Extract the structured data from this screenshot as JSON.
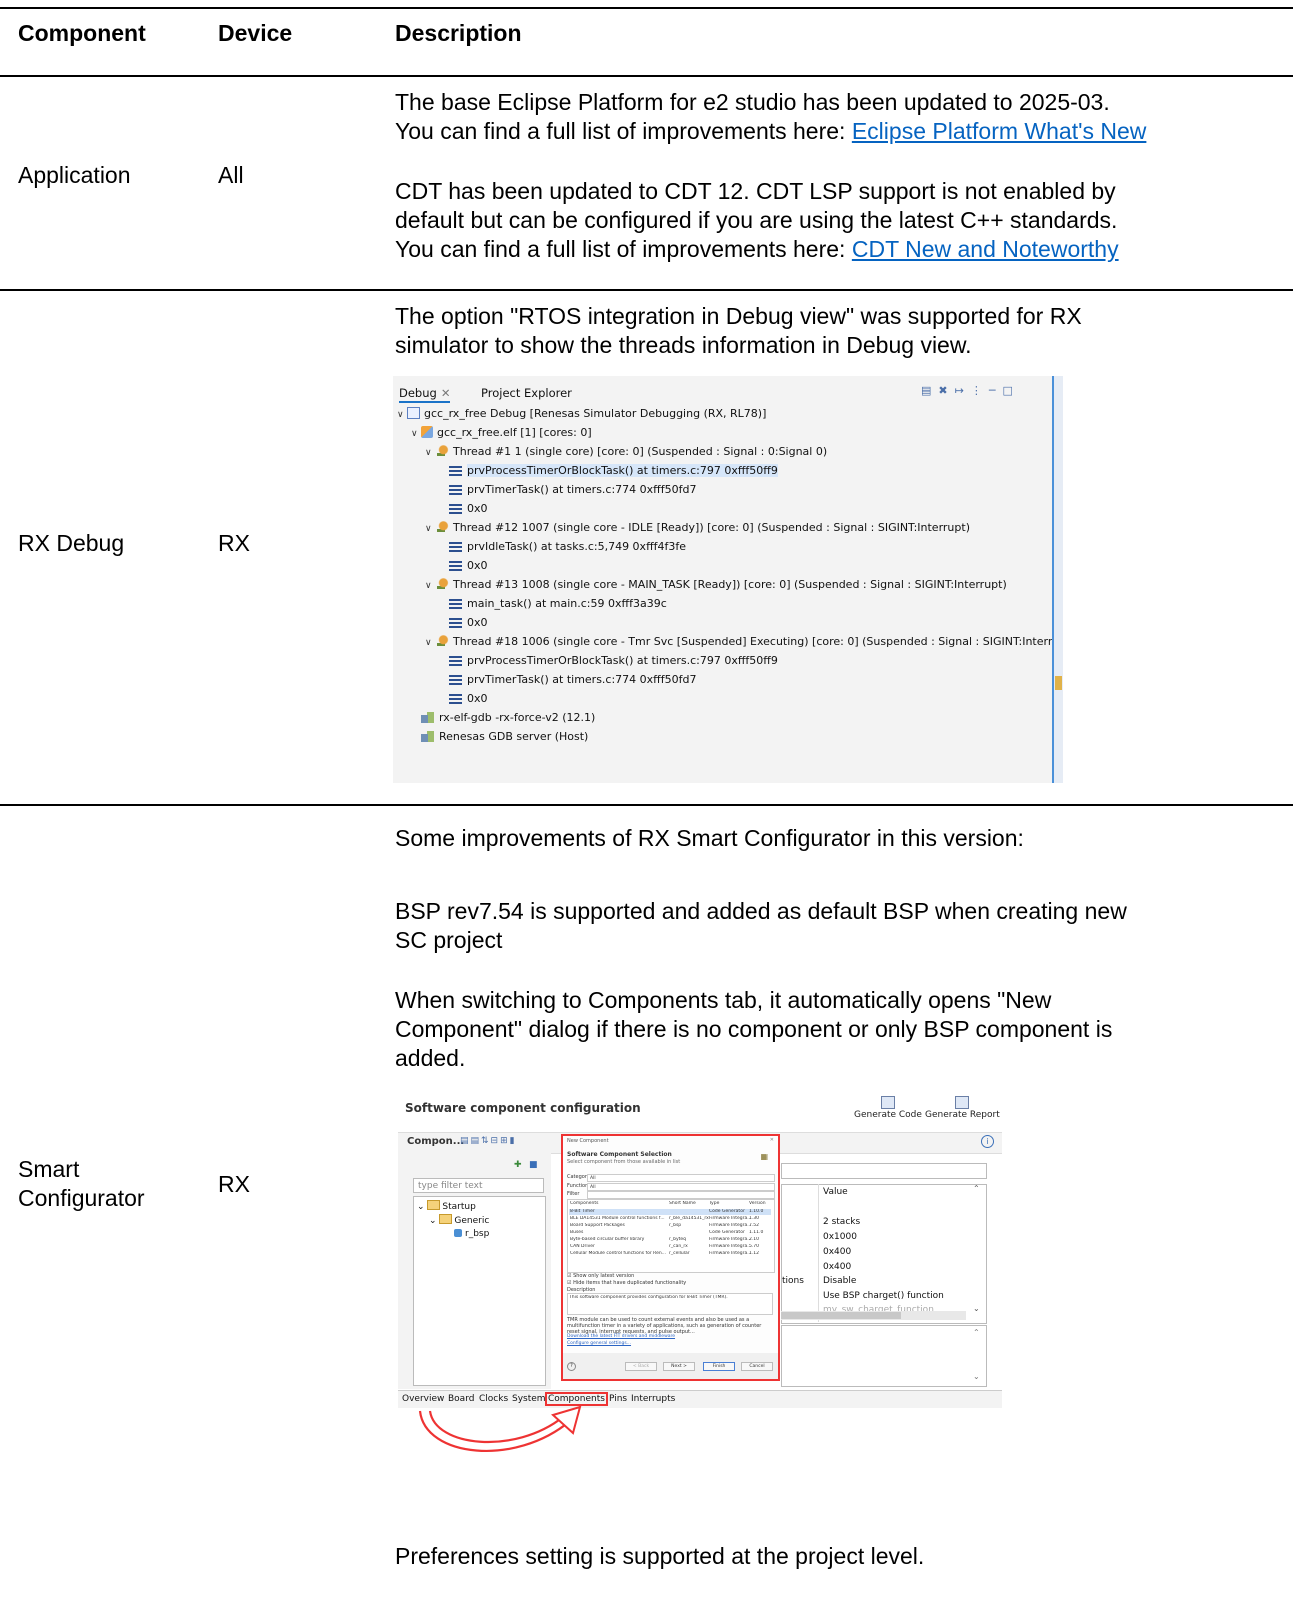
{
  "table": {
    "headers": [
      "Component",
      "Device",
      "Description"
    ],
    "rows": [
      {
        "component": "Application",
        "device": "All",
        "paragraphs": [
          {
            "lines": [
              "The base Eclipse Platform for e2 studio has been updated to 2025-03.",
              "You can find a full list of improvements here: "
            ],
            "link": "Eclipse Platform What's New"
          },
          {
            "lines": [
              "CDT has been updated to CDT 12. CDT LSP support is not enabled by",
              "default but can be configured if you are using the latest C++ standards.",
              "You can find a full list of improvements here: "
            ],
            "link": "CDT New and Noteworthy"
          }
        ]
      },
      {
        "component": "RX Debug",
        "device": "RX",
        "paragraphs": [
          {
            "lines": [
              "The option \"RTOS integration in Debug view\" was supported for RX",
              "simulator to show the threads information in Debug view."
            ]
          }
        ]
      },
      {
        "component_lines": [
          "Smart",
          "Configurator"
        ],
        "device": "RX",
        "paragraphs": [
          {
            "lines": [
              "Some improvements of RX Smart Configurator in this version:"
            ]
          },
          {
            "lines": [
              "BSP rev7.54 is supported and added as default BSP when creating new",
              "SC project"
            ]
          },
          {
            "lines": [
              "When switching to Components tab, it automatically opens \"New",
              "Component\" dialog if there is no component or only BSP component is",
              "added."
            ]
          },
          {
            "lines": [
              "Preferences setting is supported at the project level."
            ]
          }
        ]
      }
    ]
  },
  "debug_view": {
    "tabs": [
      "Debug",
      "Project Explorer"
    ],
    "close_glyph": "✕",
    "toolbar_icons": [
      "collapse-all-icon",
      "remove-terminated-icon",
      "step-icon",
      "view-menu-icon",
      "minimize-icon",
      "maximize-icon"
    ],
    "rows": [
      {
        "indent": 0,
        "chevron": true,
        "icon": "project-icon",
        "text": "gcc_rx_free Debug [Renesas Simulator Debugging (RX, RL78)]"
      },
      {
        "indent": 1,
        "chevron": true,
        "icon": "elf-icon",
        "text": "gcc_rx_free.elf [1] [cores: 0]"
      },
      {
        "indent": 2,
        "chevron": true,
        "icon": "thread-icon",
        "text": "Thread #1 1 (single core) [core: 0] (Suspended : Signal : 0:Signal 0)"
      },
      {
        "indent": 3,
        "chevron": false,
        "icon": "stack-frame-icon",
        "text": "prvProcessTimerOrBlockTask() at timers.c:797 0xfff50ff9",
        "selected": true
      },
      {
        "indent": 3,
        "chevron": false,
        "icon": "stack-frame-icon",
        "text": "prvTimerTask() at timers.c:774 0xfff50fd7"
      },
      {
        "indent": 3,
        "chevron": false,
        "icon": "stack-frame-icon",
        "text": "0x0"
      },
      {
        "indent": 2,
        "chevron": true,
        "icon": "thread-icon",
        "text": "Thread #12 1007 (single core - IDLE [Ready]) [core: 0] (Suspended : Signal : SIGINT:Interrupt)"
      },
      {
        "indent": 3,
        "chevron": false,
        "icon": "stack-frame-icon",
        "text": "prvIdleTask() at tasks.c:5,749 0xfff4f3fe"
      },
      {
        "indent": 3,
        "chevron": false,
        "icon": "stack-frame-icon",
        "text": "0x0"
      },
      {
        "indent": 2,
        "chevron": true,
        "icon": "thread-icon",
        "text": "Thread #13 1008 (single core - MAIN_TASK [Ready]) [core: 0] (Suspended : Signal : SIGINT:Interrupt)"
      },
      {
        "indent": 3,
        "chevron": false,
        "icon": "stack-frame-icon",
        "text": "main_task() at main.c:59 0xfff3a39c"
      },
      {
        "indent": 3,
        "chevron": false,
        "icon": "stack-frame-icon",
        "text": "0x0"
      },
      {
        "indent": 2,
        "chevron": true,
        "icon": "thread-icon",
        "text": "Thread #18 1006 (single core - Tmr Svc [Suspended] Executing) [core: 0] (Suspended : Signal : SIGINT:Interrupt)"
      },
      {
        "indent": 3,
        "chevron": false,
        "icon": "stack-frame-icon",
        "text": "prvProcessTimerOrBlockTask() at timers.c:797 0xfff50ff9"
      },
      {
        "indent": 3,
        "chevron": false,
        "icon": "stack-frame-icon",
        "text": "prvTimerTask() at timers.c:774 0xfff50fd7"
      },
      {
        "indent": 3,
        "chevron": false,
        "icon": "stack-frame-icon",
        "text": "0x0"
      },
      {
        "indent": 1,
        "chevron": false,
        "icon": "gdb-icon",
        "text": "rx-elf-gdb -rx-force-v2 (12.1)"
      },
      {
        "indent": 1,
        "chevron": false,
        "icon": "gdb-icon",
        "text": "Renesas GDB server (Host)"
      }
    ]
  },
  "smart_configurator": {
    "title": "Software component configuration",
    "generate_code": "Generate Code",
    "generate_report": "Generate Report",
    "components_title": "Compon...",
    "info_glyph": "i",
    "filter_placeholder": "type filter text",
    "tree": [
      "Startup",
      "Generic",
      "r_bsp"
    ],
    "value_header": "Value",
    "values": [
      "2 stacks",
      "0x1000",
      "0x400",
      "0x400",
      "Disable",
      "Use BSP charget() function",
      "my_sw_charget_function"
    ],
    "values_left_fragment": "tions",
    "dialog": {
      "window_title": "New Component",
      "heading": "Software Component Selection",
      "subheading": "Select component from those available in list",
      "category_label": "Category",
      "category_value": "All",
      "function_label": "Function",
      "function_value": "All",
      "filter_label": "Filter",
      "grid_headers": [
        "Components",
        "Short Name",
        "Type",
        "Version"
      ],
      "grid_rows": [
        [
          "8-Bit Timer",
          "",
          "Code Generator",
          "1.10.0"
        ],
        [
          "BLE DA14531 Module control functions f...",
          "r_ble_da14531_rx",
          "Firmware Integra...",
          "1.30"
        ],
        [
          "Board Support Packages",
          "r_bsp",
          "Firmware Integra...",
          "7.52"
        ],
        [
          "Buses",
          "",
          "Code Generator",
          "1.11.0"
        ],
        [
          "Byte-based circular buffer library",
          "r_byteq",
          "Firmware Integra...",
          "2.10"
        ],
        [
          "CAN Driver",
          "r_can_rx",
          "Firmware Integra...",
          "5.70"
        ],
        [
          "Cellular Module control functions for Ren...",
          "r_cellular",
          "Firmware Integra...",
          "1.12"
        ]
      ],
      "checkbox_latest": "Show only latest version",
      "checkbox_hide": "Hide items that have duplicated functionality",
      "description_label": "Description",
      "description_text": "This software component provides configuration for 8-Bit Timer (TMR).",
      "description_more": "TMR module can be used to count external events and also be used as a multifunction timer in a variety of applications, such as generation of counter reset signal, interrupt requests, and pulse output...",
      "link_download": "Download the latest FIT drivers and middleware",
      "link_configure": "Configure general settings...",
      "help_glyph": "?",
      "btn_back": "< Back",
      "btn_next": "Next >",
      "btn_finish": "Finish",
      "btn_cancel": "Cancel"
    },
    "bottom_tabs": [
      "Overview",
      "Board",
      "Clocks",
      "System",
      "Components",
      "Pins",
      "Interrupts"
    ],
    "highlighted_tab": "Components"
  }
}
